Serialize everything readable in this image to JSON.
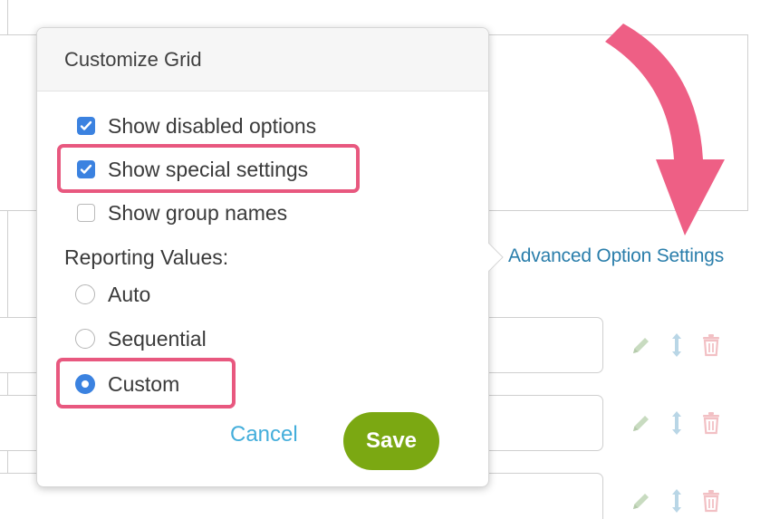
{
  "popover": {
    "title": "Customize Grid",
    "checkboxes": [
      {
        "label": "Show disabled options",
        "checked": true
      },
      {
        "label": "Show special settings",
        "checked": true
      },
      {
        "label": "Show group names",
        "checked": false
      }
    ],
    "reporting_label": "Reporting Values:",
    "radios": [
      {
        "label": "Auto",
        "selected": false
      },
      {
        "label": "Sequential",
        "selected": false
      },
      {
        "label": "Custom",
        "selected": true
      }
    ],
    "cancel_label": "Cancel",
    "save_label": "Save"
  },
  "background": {
    "advanced_link": "Advanced Option Settings",
    "row_icons": [
      "pencil-icon",
      "reorder-icon",
      "trash-icon"
    ]
  },
  "colors": {
    "highlight": "#e8587f",
    "checkbox_blue": "#3b82e0",
    "link_blue": "#2a7eab",
    "cancel_blue": "#44aedb",
    "save_green": "#7ba812",
    "icon_muted_green": "#c8dbc0",
    "icon_muted_blue": "#b9d6e6",
    "icon_muted_red": "#f2c0c4"
  }
}
